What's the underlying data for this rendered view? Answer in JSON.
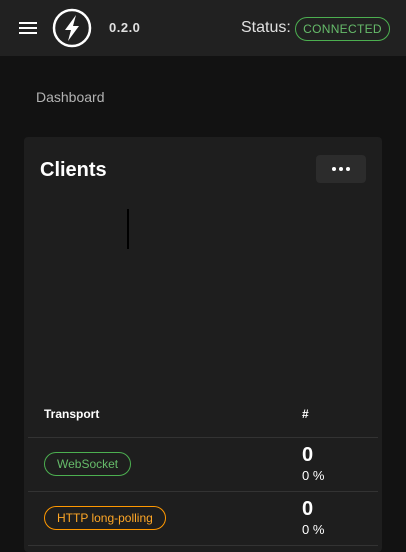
{
  "header": {
    "version": "0.2.0",
    "status_label": "Status:",
    "status_value": "CONNECTED"
  },
  "breadcrumb": "Dashboard",
  "clients_card": {
    "title": "Clients",
    "table": {
      "columns": [
        "Transport",
        "#"
      ],
      "rows": [
        {
          "transport": "WebSocket",
          "count": "0",
          "percent": "0 %"
        },
        {
          "transport": "HTTP long-polling",
          "count": "0",
          "percent": "0 %"
        }
      ]
    }
  },
  "colors": {
    "connected": "#4caf50",
    "websocket_chip": "#4caf50",
    "polling_chip": "#ff9800",
    "app_bar": "#212121",
    "card": "#1e1e1e",
    "background": "#121212"
  }
}
